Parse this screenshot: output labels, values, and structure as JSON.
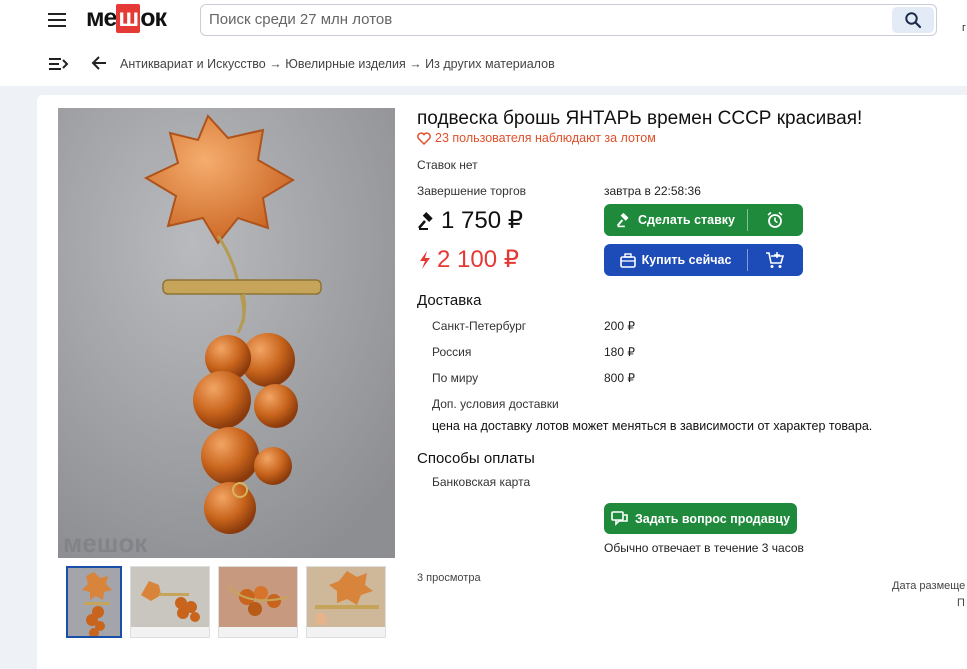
{
  "header": {
    "logo": {
      "pre": "ме",
      "box": "ш",
      "post": "ок"
    },
    "search_placeholder": "Поиск среди 27 млн лотов",
    "edge_text": "г"
  },
  "breadcrumb": "Антиквариат и Искусство → Ювелирные изделия → Из других материалов",
  "lot": {
    "title": "подвеска брошь ЯНТАРЬ времен СССР красивая!",
    "watchers": "23 пользователя наблюдают за лотом",
    "bids": "Ставок нет",
    "end_label": "Завершение торгов",
    "end_value": "завтра в 22:58:36",
    "bid_price": "1 750 ₽",
    "buy_price": "2 100 ₽",
    "bid_button": "Сделать ставку",
    "buy_button": "Купить сейчас",
    "watermark": "мешок"
  },
  "delivery": {
    "title": "Доставка",
    "rows": [
      {
        "region": "Санкт-Петербург",
        "price": "200 ₽"
      },
      {
        "region": "Россия",
        "price": "180 ₽"
      },
      {
        "region": "По миру",
        "price": "800 ₽"
      }
    ],
    "extra_label": "Доп. условия доставки",
    "note": "цена на доставку лотов может меняться в зависимости от характер товара."
  },
  "payment": {
    "title": "Способы оплаты",
    "method": "Банковская карта"
  },
  "seller": {
    "ask_button": "Задать вопрос продавцу",
    "reply_note": "Обычно отвечает в течение 3 часов"
  },
  "meta": {
    "views": "3 просмотра",
    "date_label": "Дата размеще",
    "date_sub": "П"
  },
  "colors": {
    "green": "#1f8a3b",
    "blue": "#1d4bb8",
    "red": "#e53935",
    "amber": "#c8641c"
  }
}
